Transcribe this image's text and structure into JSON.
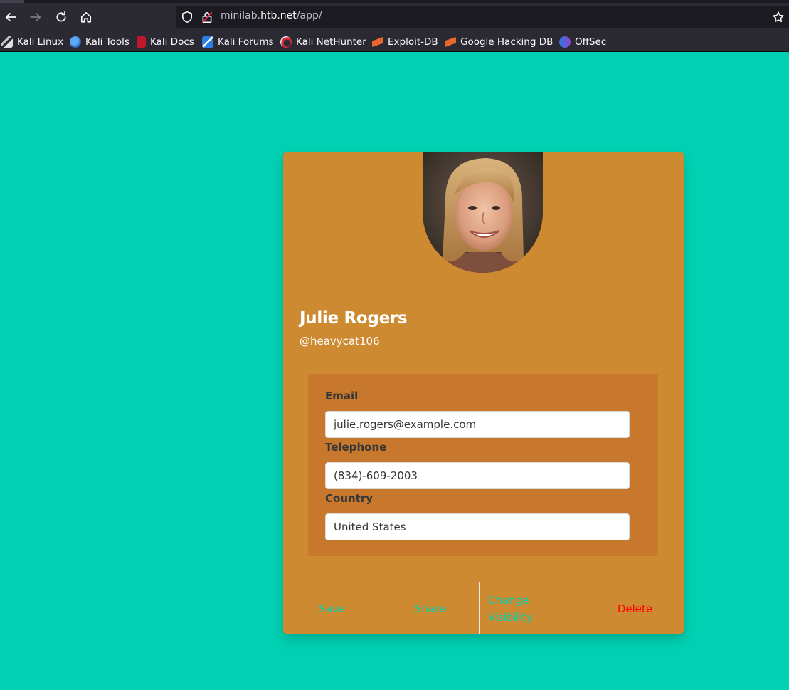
{
  "browser": {
    "url_prefix": "minilab.",
    "url_host": "htb.net",
    "url_path": "/app/",
    "bookmarks": [
      {
        "label": "Kali Linux",
        "icon": "kali-dragon-icon"
      },
      {
        "label": "Kali Tools",
        "icon": "kali-tools-icon"
      },
      {
        "label": "Kali Docs",
        "icon": "kali-docs-icon"
      },
      {
        "label": "Kali Forums",
        "icon": "kali-forums-icon"
      },
      {
        "label": "Kali NetHunter",
        "icon": "kali-nethunter-icon"
      },
      {
        "label": "Exploit-DB",
        "icon": "exploit-db-icon"
      },
      {
        "label": "Google Hacking DB",
        "icon": "ghdb-icon"
      },
      {
        "label": "OffSec",
        "icon": "offsec-icon"
      }
    ]
  },
  "profile": {
    "name": "Julie Rogers",
    "handle": "@heavycat106",
    "email_label": "Email",
    "email": "julie.rogers@example.com",
    "telephone_label": "Telephone",
    "telephone": "(834)-609-2003",
    "country_label": "Country",
    "country": "United States"
  },
  "actions": {
    "save": "Save",
    "share": "Share",
    "visibility_line1": "Change",
    "visibility_line2": "Visibility",
    "delete": "Delete"
  },
  "colors": {
    "page_bg": "#00d1b2",
    "card_bg": "#cd8a30",
    "info_bg": "#c8782d",
    "action_link": "#00d1b2",
    "delete_link": "#ff0000"
  }
}
